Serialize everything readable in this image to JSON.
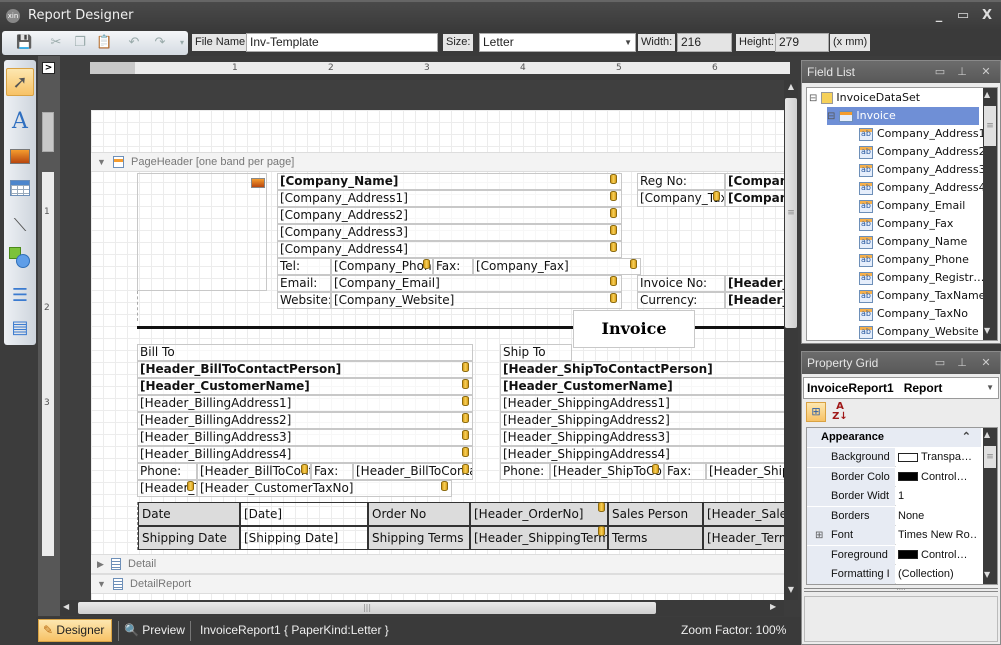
{
  "window": {
    "title": "Report Designer",
    "logo": "xin",
    "minimize": "_",
    "maximize": "▭",
    "close": "X"
  },
  "toolbar": {
    "icons": [
      "save-icon",
      "cut-icon",
      "copy-icon",
      "paste-icon",
      "undo-icon",
      "redo-icon",
      "dropdown-icon"
    ],
    "file_name_label": "File Name:",
    "file_name_value": "Inv-Template",
    "size_label": "Size:",
    "size_value": "Letter",
    "width_label": "Width:",
    "width_value": "216",
    "height_label": "Height:",
    "height_value": "279",
    "unit_label": "(x mm)"
  },
  "tools": [
    "pointer-tool",
    "label-tool",
    "picture-tool",
    "table-tool",
    "line-tool",
    "shape-tool",
    "cross-band-line-tool",
    "cross-band-box-tool"
  ],
  "ruler": {
    "h_labels": [
      "1",
      "2",
      "3",
      "4",
      "5",
      "6"
    ],
    "v_labels": [
      "1",
      "2",
      "3"
    ]
  },
  "bands": {
    "page_header": "PageHeader [one band per page]",
    "detail": "Detail",
    "detail_report": "DetailReport"
  },
  "company": {
    "name": "[Company_Name]",
    "address1": "[Company_Address1]",
    "address2": "[Company_Address2]",
    "address3": "[Company_Address3]",
    "address4": "[Company_Address4]",
    "tel_label": "Tel:",
    "phone": "[Company_Phone]",
    "fax_label": "Fax:",
    "fax": "[Company_Fax]",
    "email_label": "Email:",
    "email": "[Company_Email]",
    "website_label": "Website:",
    "website": "[Company_Website]",
    "reg_label": "Reg No:",
    "reg_value": "[Company_RegistrationNo]",
    "tax_name": "[Company_TaxName]",
    "tax_value": "[Company_TaxNo]",
    "invoice_no_label": "Invoice No:",
    "invoice_no_value": "[Header_InvoiceNo]",
    "currency_label": "Currency:",
    "currency_value": "[Header_Currency]",
    "invoice_title": "Invoice"
  },
  "bill_to": {
    "label": "Bill To",
    "contact": "[Header_BillToContactPerson]",
    "customer": "[Header_CustomerName]",
    "address1": "[Header_BillingAddress1]",
    "address2": "[Header_BillingAddress2]",
    "address3": "[Header_BillingAddress3]",
    "address4": "[Header_BillingAddress4]",
    "phone_label": "Phone:",
    "phone": "[Header_BillToContactPhone]",
    "fax_label": "Fax:",
    "fax": "[Header_BillToContactFax]",
    "tax_label": "[Header_TaxLabel]",
    "tax_no": "[Header_CustomerTaxNo]"
  },
  "ship_to": {
    "label": "Ship To",
    "contact": "[Header_ShipToContactPerson]",
    "customer": "[Header_CustomerName]",
    "address1": "[Header_ShippingAddress1]",
    "address2": "[Header_ShippingAddress2]",
    "address3": "[Header_ShippingAddress3]",
    "address4": "[Header_ShippingAddress4]",
    "phone_label": "Phone:",
    "phone": "[Header_ShipToContactPhone]",
    "fax_label": "Fax:",
    "fax": "[Header_ShipToContactFax]"
  },
  "info_table": {
    "rows": [
      [
        "Date",
        "[Date]",
        "Order No",
        "[Header_OrderNo]",
        "Sales Person",
        "[Header_SalesPerson]"
      ],
      [
        "Shipping Date",
        "[Shipping Date]",
        "Shipping Terms",
        "[Header_ShippingTerms]",
        "Terms",
        "[Header_Terms]"
      ]
    ]
  },
  "status": {
    "designer": "Designer",
    "preview": "Preview",
    "report_info": "InvoiceReport1 { PaperKind:Letter }",
    "zoom": "Zoom Factor: 100%"
  },
  "field_list": {
    "title": "Field List",
    "dataset": "InvoiceDataSet",
    "table": "Invoice",
    "fields": [
      "Company_Address1",
      "Company_Address2",
      "Company_Address3",
      "Company_Address4",
      "Company_Email",
      "Company_Fax",
      "Company_Name",
      "Company_Phone",
      "Company_Registr…",
      "Company_TaxName",
      "Company_TaxNo",
      "Company_Website"
    ]
  },
  "property_grid": {
    "title": "Property Grid",
    "selected_object": "InvoiceReport1",
    "selected_type": "Report",
    "category": "Appearance",
    "rows": [
      {
        "name": "Background",
        "value": "Transpa…",
        "swatch": "#ffffff"
      },
      {
        "name": "Border Colo",
        "value": "Control…",
        "swatch": "#000000"
      },
      {
        "name": "Border Widt",
        "value": "1"
      },
      {
        "name": "Borders",
        "value": "None"
      },
      {
        "name": "Font",
        "value": "Times New Ro…",
        "expandable": true
      },
      {
        "name": "Foreground",
        "value": "Control…",
        "swatch": "#000000"
      },
      {
        "name": "Formatting I",
        "value": "(Collection)"
      }
    ]
  },
  "colors": {
    "accent": "#f7c266",
    "selection": "#6f8fd6",
    "chrome": "#3a3a3a"
  }
}
